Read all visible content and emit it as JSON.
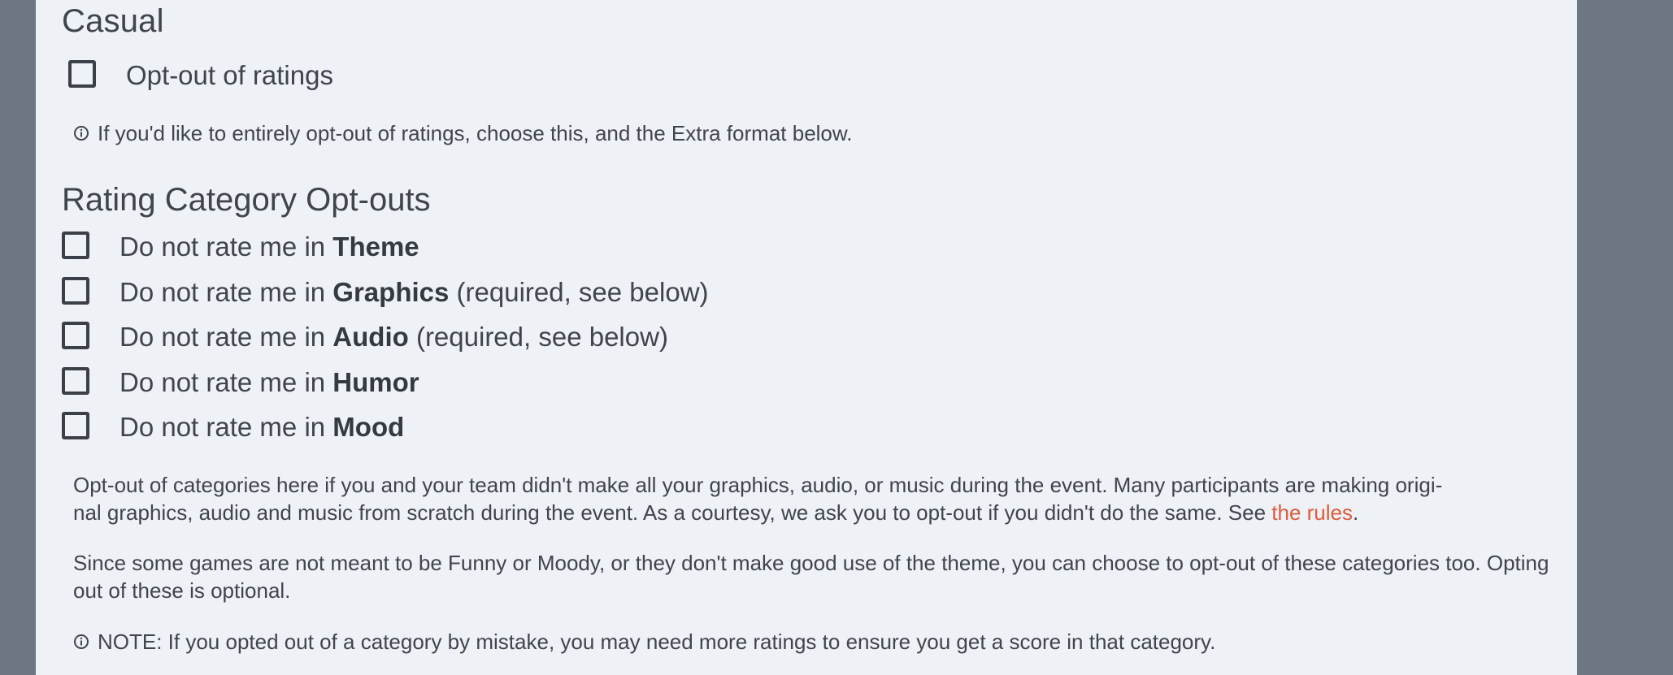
{
  "casual": {
    "heading": "Casual",
    "optout_label": "Opt-out of ratings",
    "note": "If you'd like to entirely opt-out of ratings, choose this, and the Extra format below."
  },
  "rating_optouts": {
    "heading": "Rating Category Opt-outs",
    "prefix": "Do not rate me in",
    "suffix": "(required, see below)",
    "categories": [
      {
        "name": "Theme",
        "required_note": ""
      },
      {
        "name": "Graphics",
        "required_note": "(required, see below)"
      },
      {
        "name": "Audio",
        "required_note": "(required, see below)"
      },
      {
        "name": "Humor",
        "required_note": ""
      },
      {
        "name": "Mood",
        "required_note": ""
      }
    ],
    "para1_text": "Opt-out of categories here if you and your team didn't make all your graphics, audio, or music during the event. Many participants are making origi-nal graphics, audio and music from scratch during the event. As a courtesy, we ask you to opt-out if you didn't do the same. See",
    "para1_line1": "Opt-out of categories here if you and your team didn't make all your graphics, audio, or music during the event. Many participants are making origi-",
    "para1_line2": "nal graphics, audio and music from scratch during the event. As a courtesy, we ask you to opt-out if you didn't do the same. See ",
    "rules_link": "the rules",
    "para1_end": ".",
    "para2": "Since some games are not meant to be Funny or Moody, or they don't make good use of the theme, you can choose to opt-out of these categories too. Opting out of these is optional.",
    "note": "NOTE: If you opted out of a category by mistake, you may need more ratings to ensure you get a score in that category."
  },
  "colors": {
    "background": "#6d7682",
    "panel": "#eef1f6",
    "text": "#3f454d",
    "link": "#e15a3b"
  },
  "icons": [
    "info-icon"
  ]
}
